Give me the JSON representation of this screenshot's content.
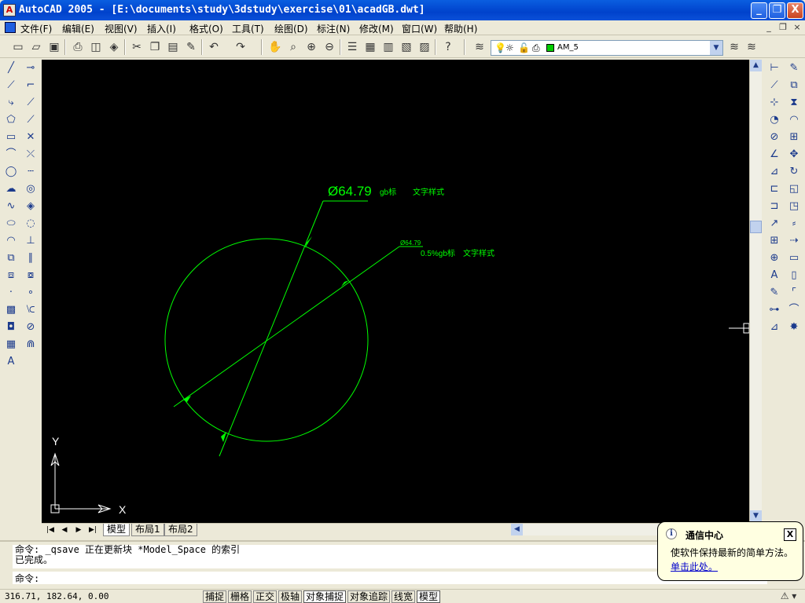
{
  "window": {
    "title": "AutoCAD 2005 - [E:\\documents\\study\\3dstudy\\exercise\\01\\acadGB.dwt]",
    "minimize": "_",
    "restore": "❐",
    "close": "X"
  },
  "menu": {
    "items": [
      "文件(F)",
      "编辑(E)",
      "视图(V)",
      "插入(I)",
      "格式(O)",
      "工具(T)",
      "绘图(D)",
      "标注(N)",
      "修改(M)",
      "窗口(W)",
      "帮助(H)"
    ],
    "mdi_min": "_",
    "mdi_restore": "❐",
    "mdi_close": "×"
  },
  "layer": {
    "current": "AM_5",
    "color": "#00cc00"
  },
  "drawing": {
    "dim1_text": "Ø64.79",
    "dim1_style": "gb标",
    "dim1_font": "文字样式",
    "dim2_text": "Ø64.79",
    "dim2_style": "0.5%gb标",
    "dim2_font": "文字样式",
    "ucs_y": "Y",
    "ucs_x": "X",
    "line_color": "#00ff00"
  },
  "layout_tabs": [
    "模型",
    "布局1",
    "布局2"
  ],
  "command": {
    "line1": "命令: _qsave 正在更新块 *Model_Space 的索引",
    "line2": "已完成。",
    "prompt": "命令:"
  },
  "status": {
    "coords": "316.71, 182.64, 0.00",
    "buttons": [
      "捕捉",
      "栅格",
      "正交",
      "极轴",
      "对象捕捉",
      "对象追踪",
      "线宽",
      "模型"
    ]
  },
  "bubble": {
    "title": "通信中心",
    "text": "使软件保持最新的简单方法。",
    "link": "单击此处。",
    "close": "X"
  }
}
